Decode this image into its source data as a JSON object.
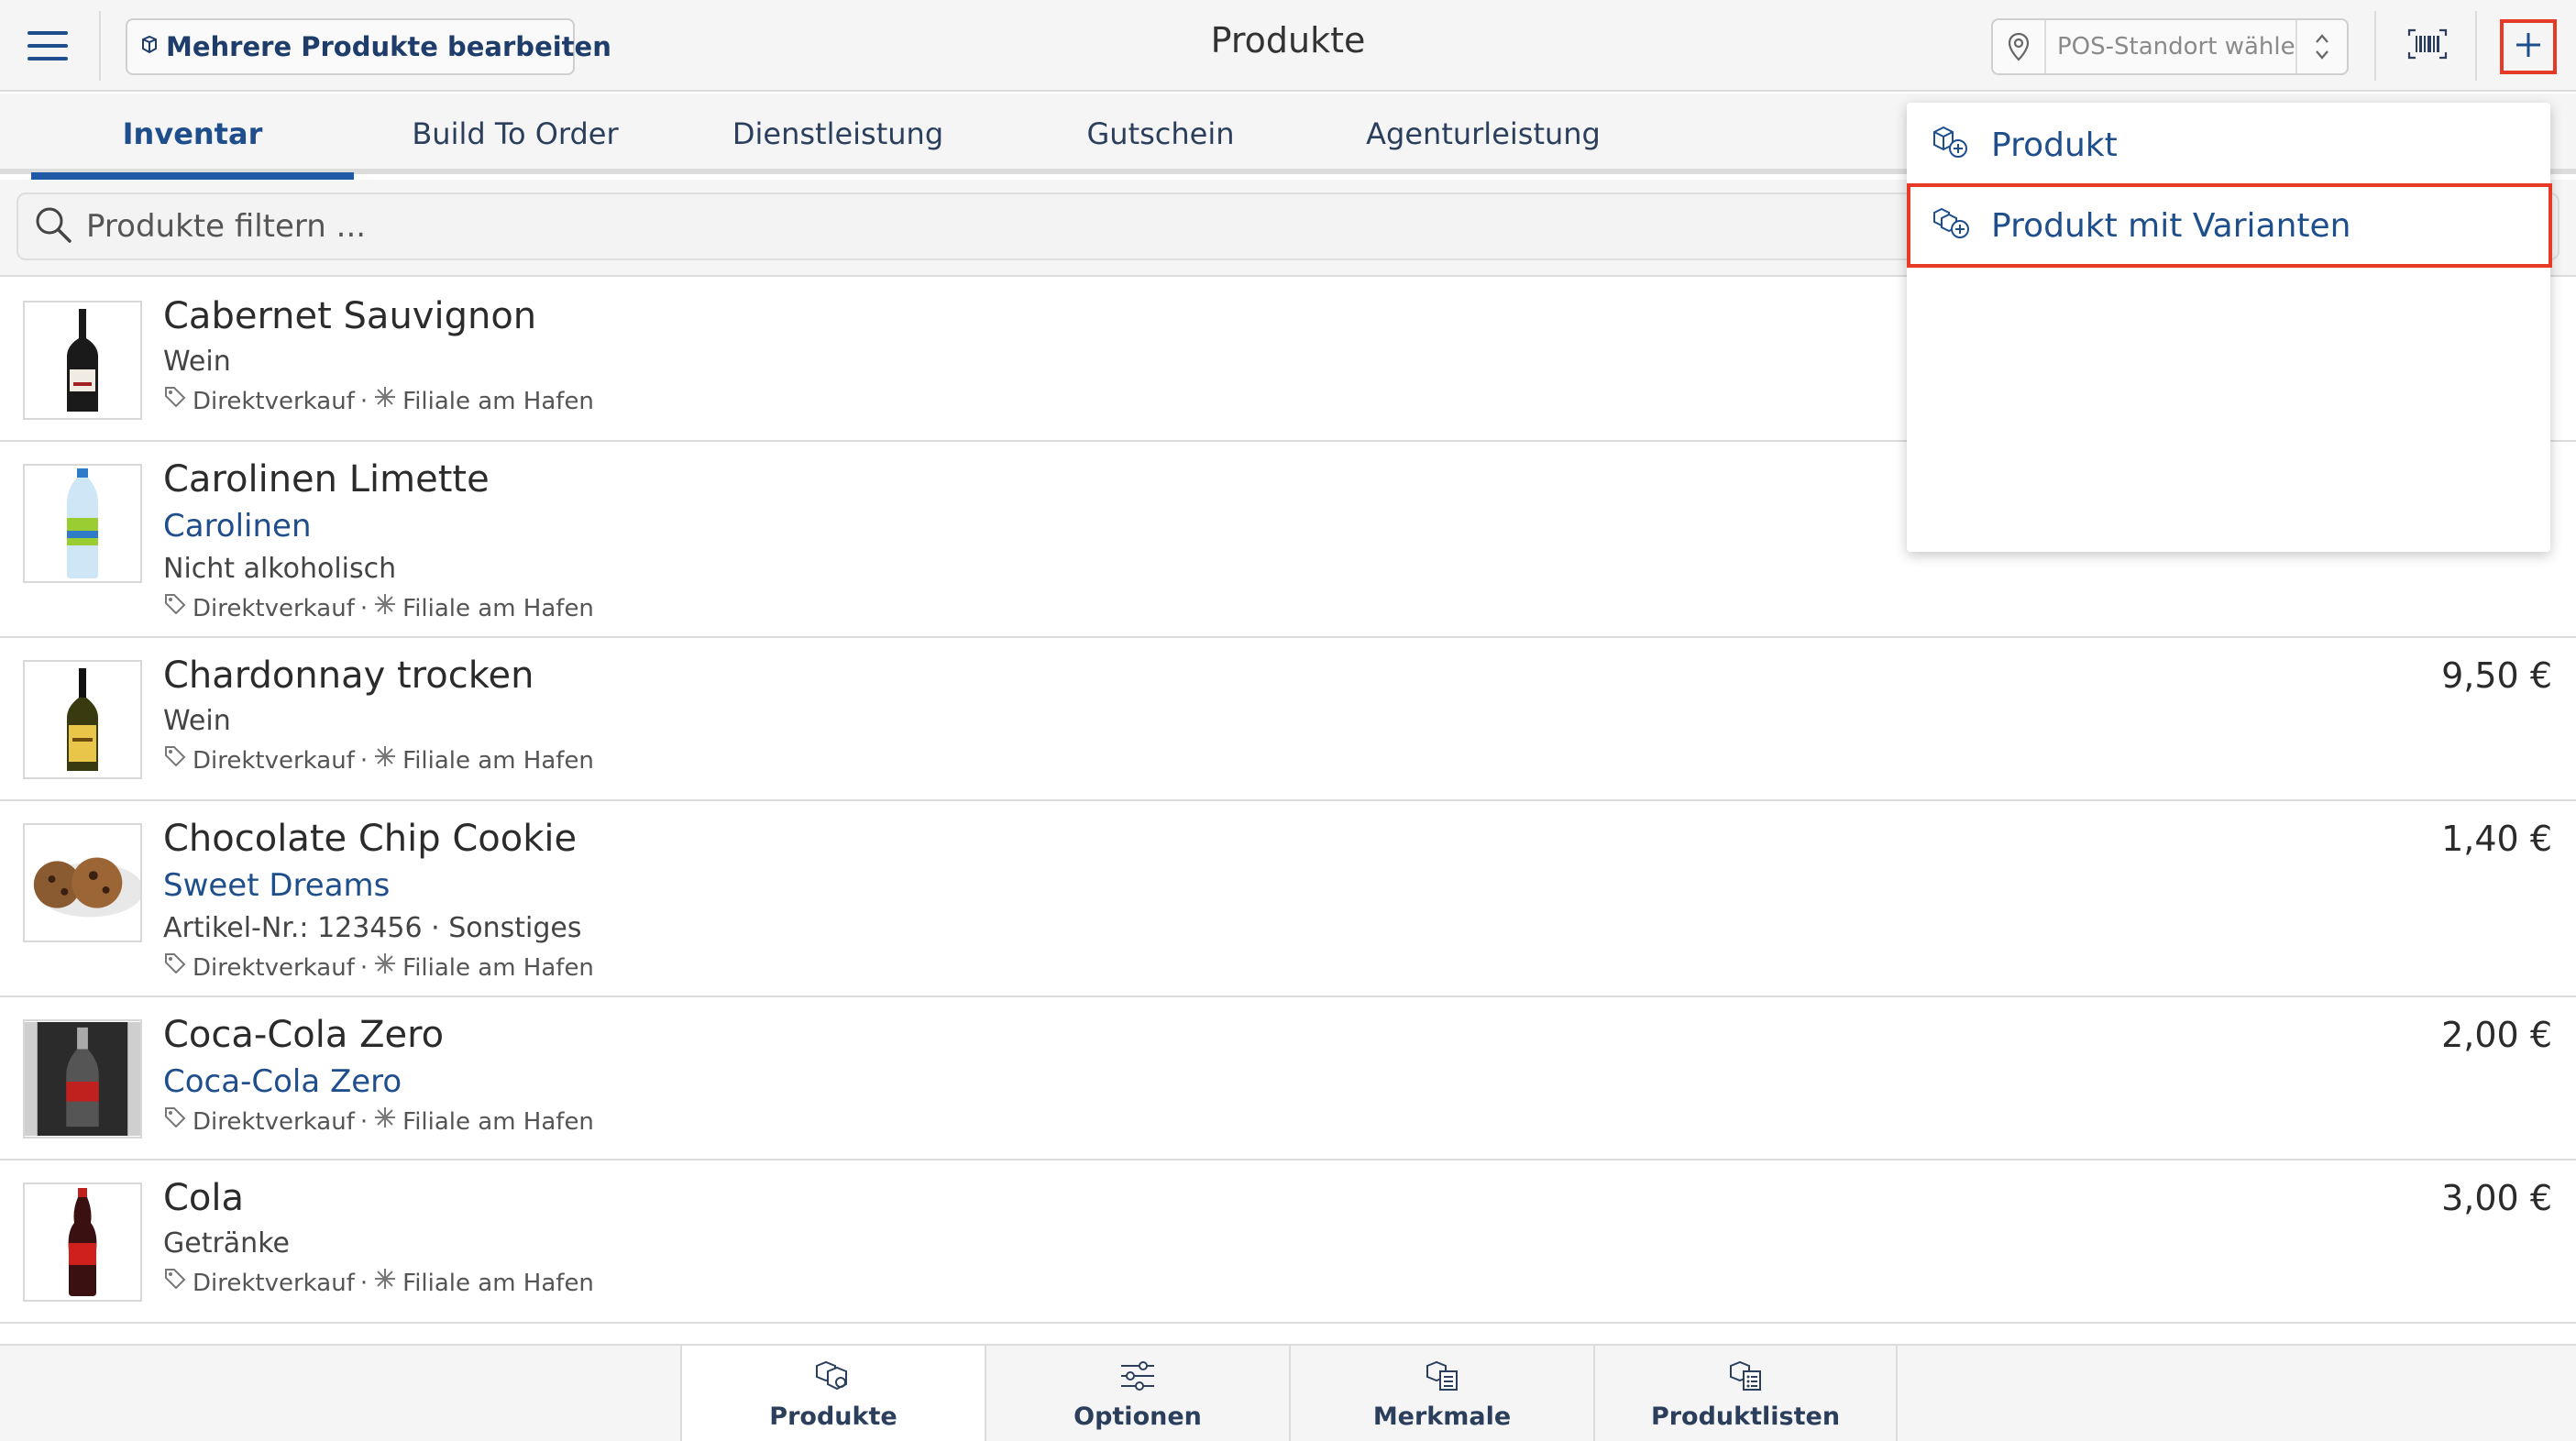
{
  "header": {
    "title": "Produkte",
    "bulk_edit_label": "Mehrere Produkte bearbeiten",
    "pos_placeholder": "POS-Standort wählen..."
  },
  "tabs": [
    {
      "label": "Inventar",
      "active": true
    },
    {
      "label": "Build To Order",
      "active": false
    },
    {
      "label": "Dienstleistung",
      "active": false
    },
    {
      "label": "Gutschein",
      "active": false
    },
    {
      "label": "Agenturleistung",
      "active": false
    }
  ],
  "search": {
    "placeholder": "Produkte filtern ..."
  },
  "products": [
    {
      "name": "Cabernet Sauvignon",
      "brand": "",
      "subtitle": "Wein",
      "meta_sale": "Direktverkauf",
      "meta_store": "Filiale am Hafen",
      "price": ""
    },
    {
      "name": "Carolinen Limette",
      "brand": "Carolinen",
      "subtitle": "Nicht alkoholisch",
      "meta_sale": "Direktverkauf",
      "meta_store": "Filiale am Hafen",
      "price": ""
    },
    {
      "name": "Chardonnay trocken",
      "brand": "",
      "subtitle": "Wein",
      "meta_sale": "Direktverkauf",
      "meta_store": "Filiale am Hafen",
      "price": "9,50 €"
    },
    {
      "name": "Chocolate Chip Cookie",
      "brand": "Sweet Dreams",
      "subtitle": "Artikel-Nr.: 123456 · Sonstiges",
      "meta_sale": "Direktverkauf",
      "meta_store": "Filiale am Hafen",
      "price": "1,40 €"
    },
    {
      "name": "Coca-Cola Zero",
      "brand": "Coca-Cola Zero",
      "subtitle": "",
      "meta_sale": "Direktverkauf",
      "meta_store": "Filiale am Hafen",
      "price": "2,00 €"
    },
    {
      "name": "Cola",
      "brand": "",
      "subtitle": "Getränke",
      "meta_sale": "Direktverkauf",
      "meta_store": "Filiale am Hafen",
      "price": "3,00 €"
    }
  ],
  "dropdown": {
    "items": [
      {
        "label": "Produkt",
        "highlighted": false
      },
      {
        "label": "Produkt mit Varianten",
        "highlighted": true
      }
    ]
  },
  "bottom_nav": [
    {
      "label": "Produkte",
      "active": true,
      "icon": "products-icon"
    },
    {
      "label": "Optionen",
      "active": false,
      "icon": "options-icon"
    },
    {
      "label": "Merkmale",
      "active": false,
      "icon": "attributes-icon"
    },
    {
      "label": "Produktlisten",
      "active": false,
      "icon": "product-lists-icon"
    }
  ],
  "colors": {
    "accent": "#1f4e8c",
    "highlight_border": "#e53a26",
    "background_bar": "#f5f5f5"
  }
}
